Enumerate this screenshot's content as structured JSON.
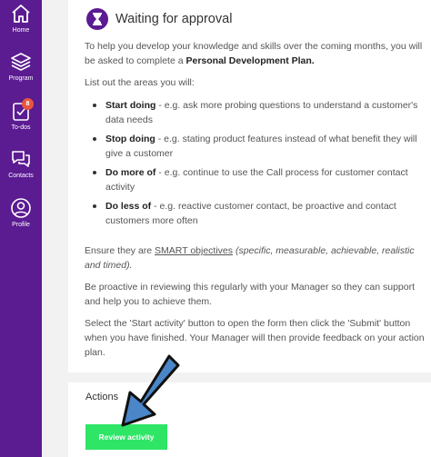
{
  "sidebar": {
    "items": [
      {
        "label": "Home",
        "icon": "home-icon"
      },
      {
        "label": "Program",
        "icon": "layers-icon"
      },
      {
        "label": "To-dos",
        "icon": "clipboard-check-icon",
        "badge": "8"
      },
      {
        "label": "Contacts",
        "icon": "chat-bubbles-icon"
      },
      {
        "label": "Profile",
        "icon": "user-circle-icon"
      }
    ]
  },
  "card": {
    "title": "Waiting for approval",
    "intro_text": "To help you develop your knowledge and skills over the coming months, you will be asked to complete a ",
    "intro_bold": "Personal Development Plan.",
    "list_intro": "List out the areas you will:",
    "bullets": [
      {
        "bold": "Start doing",
        "text": " - e.g. ask more probing questions to understand a customer's data needs"
      },
      {
        "bold": "Stop doing",
        "text": " - e.g. stating product features instead of what benefit they will give a customer"
      },
      {
        "bold": "Do more of",
        "text": " - e.g. continue to use the Call process for customer contact activity"
      },
      {
        "bold": "Do less of",
        "text": " - e.g. reactive customer contact, be proactive and contact customers more often"
      }
    ],
    "smart_prefix": "Ensure they are ",
    "smart_link": "SMART objectives",
    "smart_italic": " (specific, measurable, achievable, realistic and timed).",
    "review_text": "Be proactive in reviewing this regularly with your Manager so they can support and help you to achieve them.",
    "instructions_text": "Select the 'Start activity' button to open the form then click the 'Submit' button when you have finished. Your Manager will then provide feedback on your action plan."
  },
  "actions": {
    "title": "Actions",
    "button_label": "Review activity"
  },
  "colors": {
    "sidebar": "#5b1b91",
    "button": "#2ee566",
    "badge": "#e7563f",
    "arrow_fill": "#4a86c8",
    "arrow_stroke": "#101010"
  }
}
